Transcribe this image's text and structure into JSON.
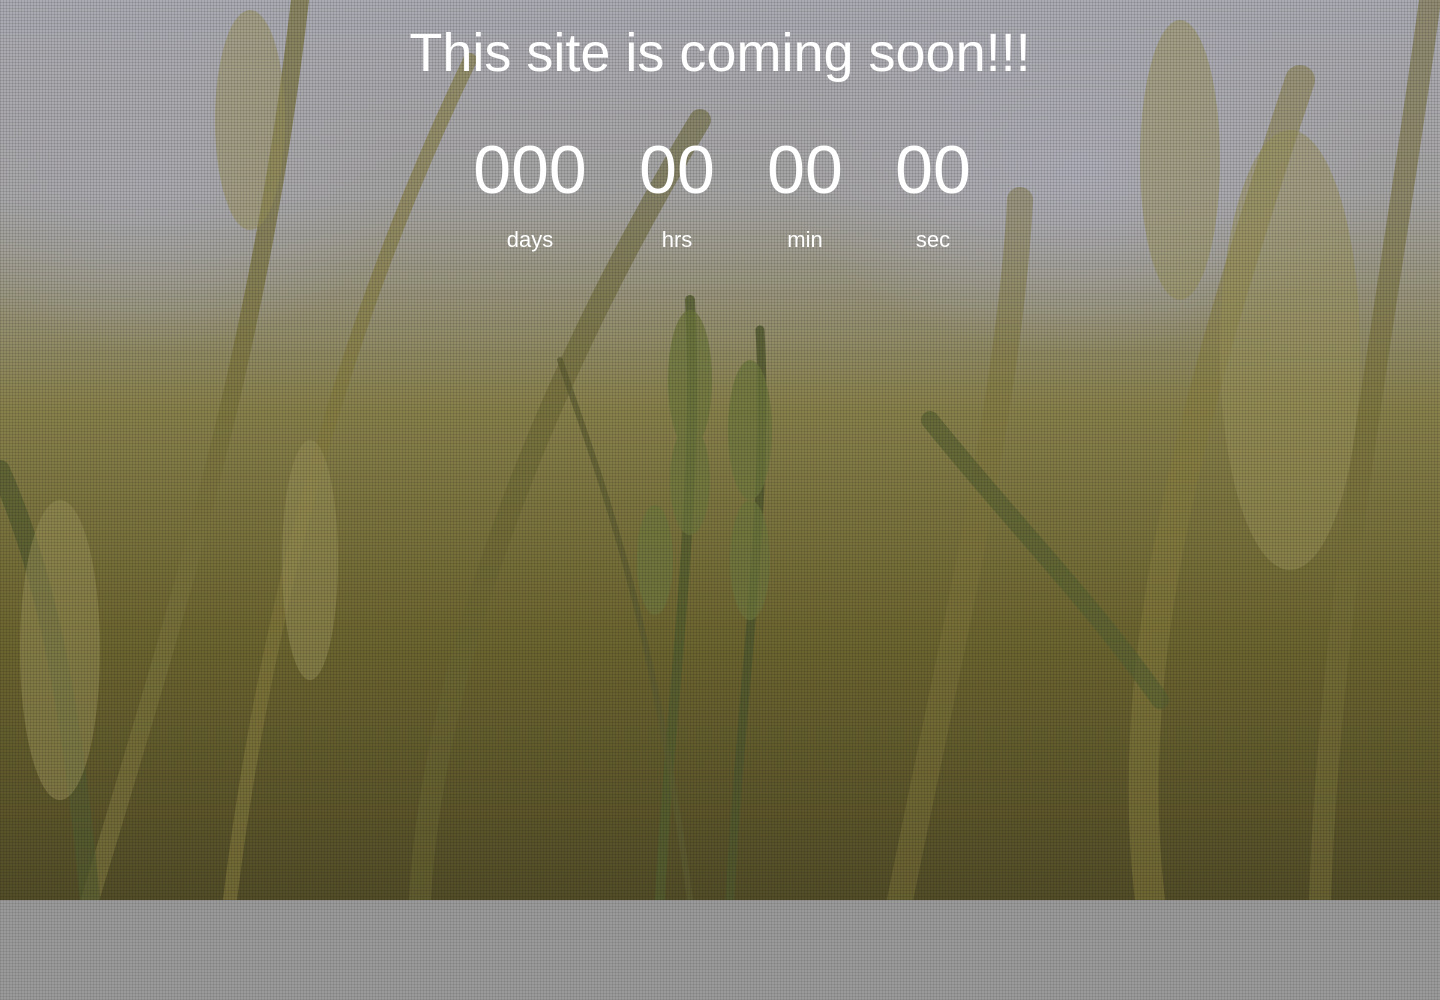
{
  "page": {
    "title": "This site is coming soon!!!"
  },
  "countdown": {
    "days": {
      "value": "000",
      "label": "days"
    },
    "hours": {
      "value": "00",
      "label": "hrs"
    },
    "minutes": {
      "value": "00",
      "label": "min"
    },
    "seconds": {
      "value": "00",
      "label": "sec"
    }
  },
  "colors": {
    "text": "#ffffff",
    "page_background": "#9a9a9a"
  },
  "background_image": {
    "subject": "wheat-field-photo"
  }
}
